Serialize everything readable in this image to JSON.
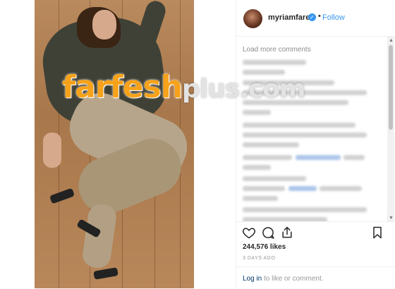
{
  "post": {
    "username": "myriamfares",
    "verified_mark": "✓",
    "separator": "•",
    "follow_label": "Follow"
  },
  "watermark": {
    "part1": "farfesh",
    "part2": "plus.com"
  },
  "comments": {
    "load_more_label": "Load more comments"
  },
  "actions": {
    "like_icon": "heart-outline",
    "comment_icon": "speech-bubble",
    "share_icon": "share-arrow",
    "save_icon": "bookmark",
    "likes_text": "244,576 likes",
    "date_text": "3 DAYS AGO"
  },
  "login": {
    "link_label": "Log in",
    "suffix": " to like or comment."
  },
  "colors": {
    "accent": "#3897f0",
    "watermark_orange": "#f6a21a"
  }
}
